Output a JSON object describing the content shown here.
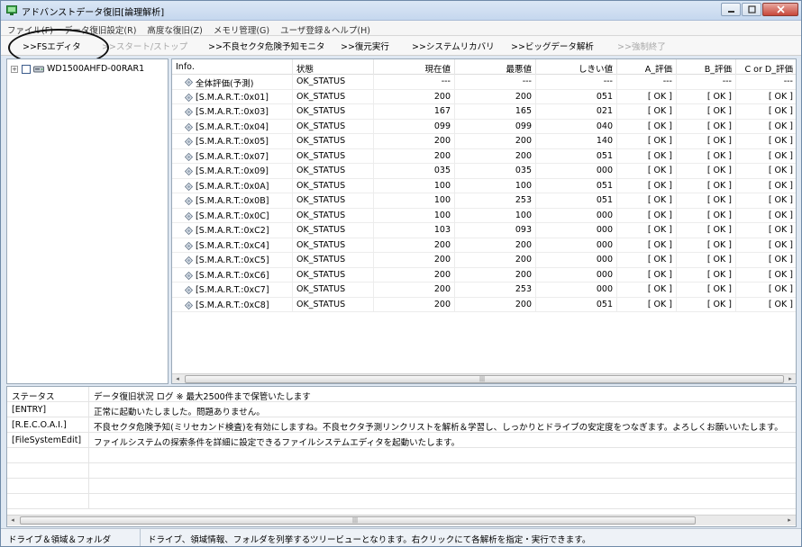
{
  "window": {
    "title": "アドバンストデータ復旧[論理解析]",
    "accent": "#dfe8f2"
  },
  "menu": [
    "ファイル(F)",
    "データ復旧設定(R)",
    "高度な復旧(Z)",
    "メモリ管理(G)",
    "ユーザ登録＆ヘルプ(H)"
  ],
  "toolbar": {
    "fs_editor": ">>FSエディタ",
    "start_stop": ">>スタート/ストップ",
    "bad_sector_monitor": ">>不良セクタ危険予知モニタ",
    "restore": ">>復元実行",
    "system_recovery": ">>システムリカバリ",
    "big_data": ">>ビッグデータ解析",
    "force_quit": ">>強制終了"
  },
  "tree": {
    "expander": "+",
    "drive_label": "WD1500AHFD-00RAR1"
  },
  "grid": {
    "columns": [
      "Info.",
      "状態",
      "現在値",
      "最悪値",
      "しきい値",
      "A_評価",
      "B_評価",
      "C or D_評価"
    ],
    "rows": [
      [
        "全体評価(予測)",
        "OK_STATUS",
        "---",
        "---",
        "---",
        "---",
        "---",
        "---"
      ],
      [
        "[S.M.A.R.T.:0x01]",
        "OK_STATUS",
        "200",
        "200",
        "051",
        "[ OK ]",
        "[ OK ]",
        "[ OK ]"
      ],
      [
        "[S.M.A.R.T.:0x03]",
        "OK_STATUS",
        "167",
        "165",
        "021",
        "[ OK ]",
        "[ OK ]",
        "[ OK ]"
      ],
      [
        "[S.M.A.R.T.:0x04]",
        "OK_STATUS",
        "099",
        "099",
        "040",
        "[ OK ]",
        "[ OK ]",
        "[ OK ]"
      ],
      [
        "[S.M.A.R.T.:0x05]",
        "OK_STATUS",
        "200",
        "200",
        "140",
        "[ OK ]",
        "[ OK ]",
        "[ OK ]"
      ],
      [
        "[S.M.A.R.T.:0x07]",
        "OK_STATUS",
        "200",
        "200",
        "051",
        "[ OK ]",
        "[ OK ]",
        "[ OK ]"
      ],
      [
        "[S.M.A.R.T.:0x09]",
        "OK_STATUS",
        "035",
        "035",
        "000",
        "[ OK ]",
        "[ OK ]",
        "[ OK ]"
      ],
      [
        "[S.M.A.R.T.:0x0A]",
        "OK_STATUS",
        "100",
        "100",
        "051",
        "[ OK ]",
        "[ OK ]",
        "[ OK ]"
      ],
      [
        "[S.M.A.R.T.:0x0B]",
        "OK_STATUS",
        "100",
        "253",
        "051",
        "[ OK ]",
        "[ OK ]",
        "[ OK ]"
      ],
      [
        "[S.M.A.R.T.:0x0C]",
        "OK_STATUS",
        "100",
        "100",
        "000",
        "[ OK ]",
        "[ OK ]",
        "[ OK ]"
      ],
      [
        "[S.M.A.R.T.:0xC2]",
        "OK_STATUS",
        "103",
        "093",
        "000",
        "[ OK ]",
        "[ OK ]",
        "[ OK ]"
      ],
      [
        "[S.M.A.R.T.:0xC4]",
        "OK_STATUS",
        "200",
        "200",
        "000",
        "[ OK ]",
        "[ OK ]",
        "[ OK ]"
      ],
      [
        "[S.M.A.R.T.:0xC5]",
        "OK_STATUS",
        "200",
        "200",
        "000",
        "[ OK ]",
        "[ OK ]",
        "[ OK ]"
      ],
      [
        "[S.M.A.R.T.:0xC6]",
        "OK_STATUS",
        "200",
        "200",
        "000",
        "[ OK ]",
        "[ OK ]",
        "[ OK ]"
      ],
      [
        "[S.M.A.R.T.:0xC7]",
        "OK_STATUS",
        "200",
        "253",
        "000",
        "[ OK ]",
        "[ OK ]",
        "[ OK ]"
      ],
      [
        "[S.M.A.R.T.:0xC8]",
        "OK_STATUS",
        "200",
        "200",
        "051",
        "[ OK ]",
        "[ OK ]",
        "[ OK ]"
      ]
    ]
  },
  "log": {
    "header_key": "ステータス",
    "header_value": "データ復旧状況 ログ ※ 最大2500件まで保管いたします",
    "entries": [
      [
        "[ENTRY]",
        "正常に起動いたしました。問題ありません。"
      ],
      [
        "[R.E.C.O.A.I.]",
        "不良セクタ危険予知(ミリセカンド検査)を有効にしますね。不良セクタ予測リンクリストを解析＆学習し、しっかりとドライブの安定度をつなぎます。よろしくお願いいたします。"
      ],
      [
        "[FileSystemEdit]",
        "ファイルシステムの探索条件を詳細に設定できるファイルシステムエディタを起動いたします。"
      ]
    ]
  },
  "statusbar": {
    "left": "ドライブ＆領域＆フォルダ",
    "right": "ドライブ、領域情報、フォルダを列挙するツリービューとなります。右クリックにて各解析を指定・実行できます。"
  },
  "scroll": {
    "left_arrow": "◂",
    "right_arrow": "▸",
    "grip": "|||"
  }
}
